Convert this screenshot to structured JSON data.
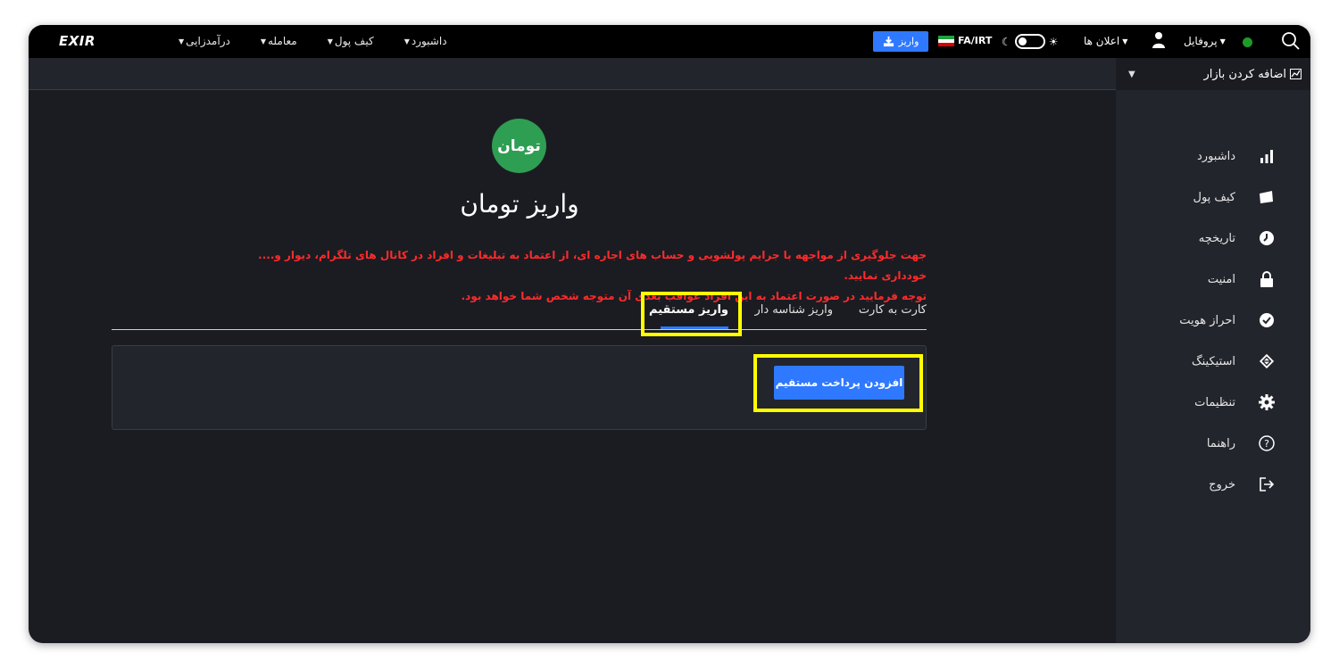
{
  "topbar": {
    "logo": "EXIR",
    "nav": {
      "income": "درآمدزایی",
      "trade": "معامله",
      "wallet": "کیف پول",
      "dashboard": "داشبورد"
    },
    "deposit_button": "واریز",
    "lang": "FA/IRT",
    "notices": "اعلان ها",
    "profile": "پروفایل"
  },
  "sidebar": {
    "market_add": "اضافه کردن بازار",
    "items": [
      {
        "label": "داشبورد",
        "icon": "bar-chart-icon"
      },
      {
        "label": "کیف پول",
        "icon": "wallet-icon"
      },
      {
        "label": "تاریخچه",
        "icon": "clock-icon"
      },
      {
        "label": "امنیت",
        "icon": "lock-icon"
      },
      {
        "label": "احراز هویت",
        "icon": "verified-badge-icon"
      },
      {
        "label": "استیکینگ",
        "icon": "staking-icon"
      },
      {
        "label": "تنظیمات",
        "icon": "gear-icon"
      },
      {
        "label": "راهنما",
        "icon": "help-icon"
      },
      {
        "label": "خروج",
        "icon": "logout-icon"
      }
    ]
  },
  "main": {
    "currency_badge": "تومان",
    "title": "واریز تومان",
    "warning_line1": "جهت جلوگیری از مواجهه با جرایم پولشویی و حساب های اجاره ای، از اعتماد به تبلیغات و افراد در کانال های تلگرام، دیوار و.... خودداری نمایید.",
    "warning_line2": "توجه فرمایید در صورت اعتماد به این افراد عواقب بعدی آن متوجه شخص شما خواهد بود.",
    "tabs": {
      "card_to_card": "کارت به کارت",
      "id_deposit": "واریز شناسه دار",
      "direct_deposit": "واریز مستقیم"
    },
    "add_direct_payment": "افزودن پرداخت مستقیم"
  },
  "colors": {
    "accent": "#2e79ff",
    "badge_green": "#2e9e53",
    "warning_red": "#ff2b2b",
    "highlight": "#ffff00"
  }
}
